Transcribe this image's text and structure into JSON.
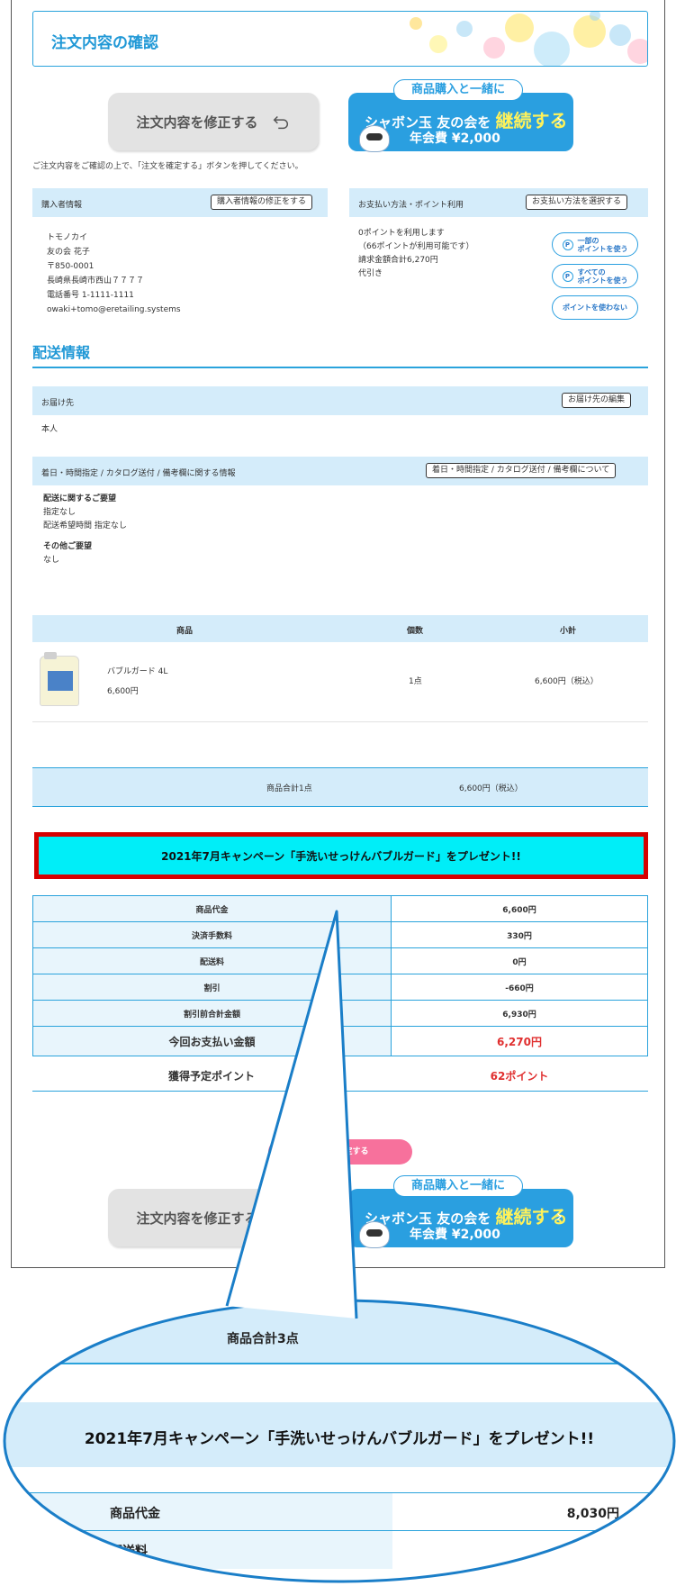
{
  "header": {
    "title": "注文内容の確認"
  },
  "buttons": {
    "modify_label": "注文内容を修正する",
    "tomo_tag": "商品購入と一緒に",
    "tomo_main_prefix": "シャボン玉 友の会を",
    "tomo_main_emph": "継続する",
    "tomo_fee": "年会費 ¥2,000",
    "confirm_label": "注文を確定する"
  },
  "notice": "ご注文内容をご確認の上で、「注文を確定する」ボタンを押してください。",
  "buyer": {
    "label": "購入者情報",
    "edit_button": "購入者情報の修正をする",
    "lines": [
      "トモノカイ",
      "友の会 花子",
      "〒850-0001",
      "長崎県長崎市西山７７７７",
      "電話番号 1-1111-1111",
      "owaki+tomo@eretailing.systems"
    ]
  },
  "payment": {
    "label": "お支払い方法・ポイント利用",
    "select_button": "お支払い方法を選択する",
    "lines": [
      "0ポイントを利用します",
      "（66ポイントが利用可能です）",
      "請求金額合計6,270円",
      "代引き"
    ],
    "use_some": "一部の\nポイントを使う",
    "use_all": "すべての\nポイントを使う",
    "use_none": "ポイントを使わない"
  },
  "shipping": {
    "section_title": "配送情報",
    "dest_label": "お届け先",
    "dest_edit": "お届け先の編集",
    "dest_value": "本人",
    "options_label": "着日・時間指定 / カタログ送付 / 備考欄に関する情報",
    "options_button": "着日・時間指定 / カタログ送付 / 備考欄について",
    "req_title": "配送に関するご要望",
    "req_lines": [
      "指定なし",
      "配送希望時間 指定なし"
    ],
    "other_title": "その他ご要望",
    "other_value": "なし"
  },
  "products": {
    "headers": [
      "商品",
      "個数",
      "小計"
    ],
    "items": [
      {
        "name": "バブルガード 4L",
        "price": "6,600円",
        "qty": "1点",
        "subtotal": "6,600円（税込）"
      }
    ],
    "total_label": "商品合計1点",
    "total_value": "6,600円（税込）"
  },
  "campaign": {
    "text": "2021年7月キャンペーン「手洗いせっけんバブルガード」をプレゼント!!"
  },
  "summary": {
    "rows": [
      {
        "label": "商品代金",
        "value": "6,600円"
      },
      {
        "label": "決済手数料",
        "value": "330円"
      },
      {
        "label": "配送料",
        "value": "0円"
      },
      {
        "label": "割引",
        "value": "-660円"
      },
      {
        "label": "割引前合計金額",
        "value": "6,930円"
      }
    ],
    "pay_label": "今回お支払い金額",
    "pay_value": "6,270円",
    "points_label": "獲得予定ポイント",
    "points_value": "62ポイント"
  },
  "zoom": {
    "total_label": "商品合計3点",
    "campaign_text": "2021年7月キャンペーン「手洗いせっけんバブルガード」をプレゼント!!",
    "row1_label": "商品代金",
    "row1_value": "8,030円",
    "row2_label": "配送料"
  },
  "colors": {
    "accent": "#2aa3dc",
    "panel_bg": "#d4ecfa",
    "campaign_bg": "#00eef8",
    "campaign_border": "#d60000",
    "price_red": "#e03030",
    "confirm_pink": "#f7719c"
  }
}
